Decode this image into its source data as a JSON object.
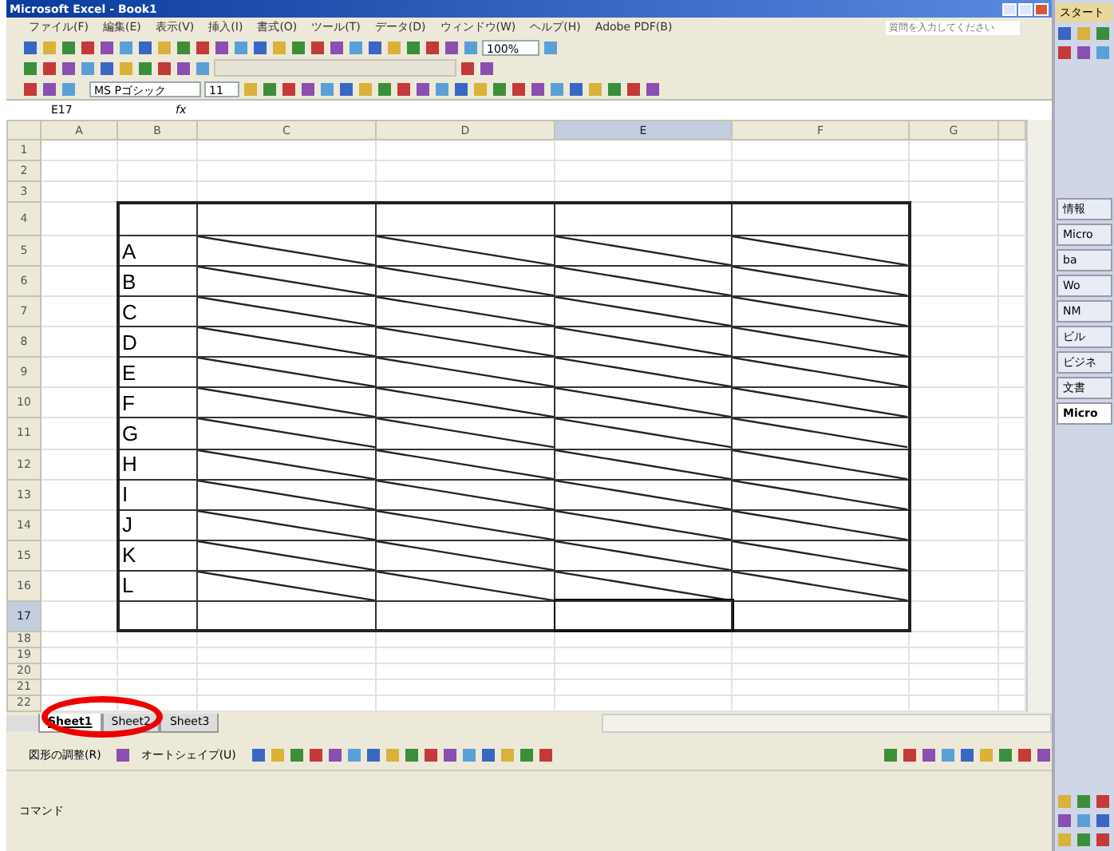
{
  "window": {
    "title": "Microsoft Excel - Book1"
  },
  "menu": [
    {
      "label": "ファイル(F)"
    },
    {
      "label": "編集(E)"
    },
    {
      "label": "表示(V)"
    },
    {
      "label": "挿入(I)"
    },
    {
      "label": "書式(O)"
    },
    {
      "label": "ツール(T)"
    },
    {
      "label": "データ(D)"
    },
    {
      "label": "ウィンドウ(W)"
    },
    {
      "label": "ヘルプ(H)"
    },
    {
      "label": "Adobe PDF(B)"
    }
  ],
  "help_search": {
    "placeholder": "質問を入力してください"
  },
  "toolbar": {
    "zoom": "100%",
    "font": "MS Pゴシック",
    "font_size": "11"
  },
  "formula_bar": {
    "name_box": "E17",
    "fx": "fx"
  },
  "columns": [
    {
      "label": "A",
      "selected": false
    },
    {
      "label": "B",
      "selected": false
    },
    {
      "label": "C",
      "selected": false
    },
    {
      "label": "D",
      "selected": false
    },
    {
      "label": "E",
      "selected": true
    },
    {
      "label": "F",
      "selected": false
    },
    {
      "label": "G",
      "selected": false
    }
  ],
  "rows": [
    {
      "label": "1",
      "selected": false
    },
    {
      "label": "2",
      "selected": false
    },
    {
      "label": "3",
      "selected": false
    },
    {
      "label": "4",
      "selected": false
    },
    {
      "label": "5",
      "selected": false
    },
    {
      "label": "6",
      "selected": false
    },
    {
      "label": "7",
      "selected": false
    },
    {
      "label": "8",
      "selected": false
    },
    {
      "label": "9",
      "selected": false
    },
    {
      "label": "10",
      "selected": false
    },
    {
      "label": "11",
      "selected": false
    },
    {
      "label": "12",
      "selected": false
    },
    {
      "label": "13",
      "selected": false
    },
    {
      "label": "14",
      "selected": false
    },
    {
      "label": "15",
      "selected": false
    },
    {
      "label": "16",
      "selected": false
    },
    {
      "label": "17",
      "selected": true
    },
    {
      "label": "18",
      "selected": false
    },
    {
      "label": "19",
      "selected": false
    },
    {
      "label": "20",
      "selected": false
    },
    {
      "label": "21",
      "selected": false
    },
    {
      "label": "22",
      "selected": false
    }
  ],
  "table": {
    "rows": [
      {
        "kind": "blank"
      },
      {
        "label": "A",
        "kind": "diagonal"
      },
      {
        "label": "B",
        "kind": "diagonal"
      },
      {
        "label": "C",
        "kind": "diagonal"
      },
      {
        "label": "D",
        "kind": "diagonal"
      },
      {
        "label": "E",
        "kind": "diagonal"
      },
      {
        "label": "F",
        "kind": "diagonal"
      },
      {
        "label": "G",
        "kind": "diagonal"
      },
      {
        "label": "H",
        "kind": "diagonal"
      },
      {
        "label": "I",
        "kind": "diagonal"
      },
      {
        "label": "J",
        "kind": "diagonal"
      },
      {
        "label": "K",
        "kind": "diagonal"
      },
      {
        "label": "L",
        "kind": "diagonal"
      },
      {
        "kind": "blank"
      }
    ]
  },
  "sheet_tabs": [
    {
      "label": "Sheet1",
      "selected": true
    },
    {
      "label": "Sheet2",
      "selected": false
    },
    {
      "label": "Sheet3",
      "selected": false
    }
  ],
  "drawing_toolbar": {
    "arrange": "図形の調整(R)",
    "autoshapes": "オートシェイプ(U)"
  },
  "status": "コマンド",
  "taskbar": {
    "start": "スタート",
    "items": [
      {
        "label": "情報",
        "selected": false
      },
      {
        "label": "Micro",
        "selected": false
      },
      {
        "label": "ba",
        "selected": false
      },
      {
        "label": "Wo",
        "selected": false
      },
      {
        "label": "NM",
        "selected": false
      },
      {
        "label": "ビル",
        "selected": false
      },
      {
        "label": "ビジネ",
        "selected": false
      },
      {
        "label": "文書",
        "selected": false
      },
      {
        "label": "Micro",
        "selected": true
      }
    ]
  }
}
